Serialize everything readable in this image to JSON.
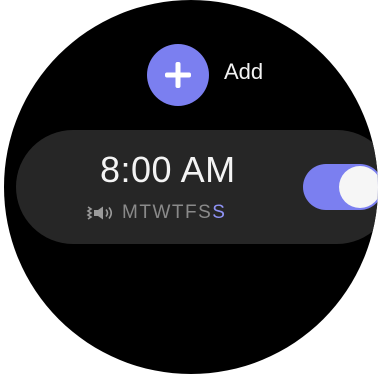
{
  "add": {
    "label": "Add",
    "icon": "plus-icon",
    "color": "#7b7ff0"
  },
  "alarm": {
    "time": "8:00 AM",
    "sound_icon": "vibrate-sound-icon",
    "days": [
      {
        "letter": "M",
        "active": false
      },
      {
        "letter": "T",
        "active": false
      },
      {
        "letter": "W",
        "active": false
      },
      {
        "letter": "T",
        "active": false
      },
      {
        "letter": "F",
        "active": false
      },
      {
        "letter": "S",
        "active": false
      },
      {
        "letter": "S",
        "active": true
      }
    ],
    "enabled": true,
    "colors": {
      "day_inactive": "#8a8a8a",
      "day_active": "#8f93f5",
      "toggle_on": "#7b7ff0"
    }
  }
}
